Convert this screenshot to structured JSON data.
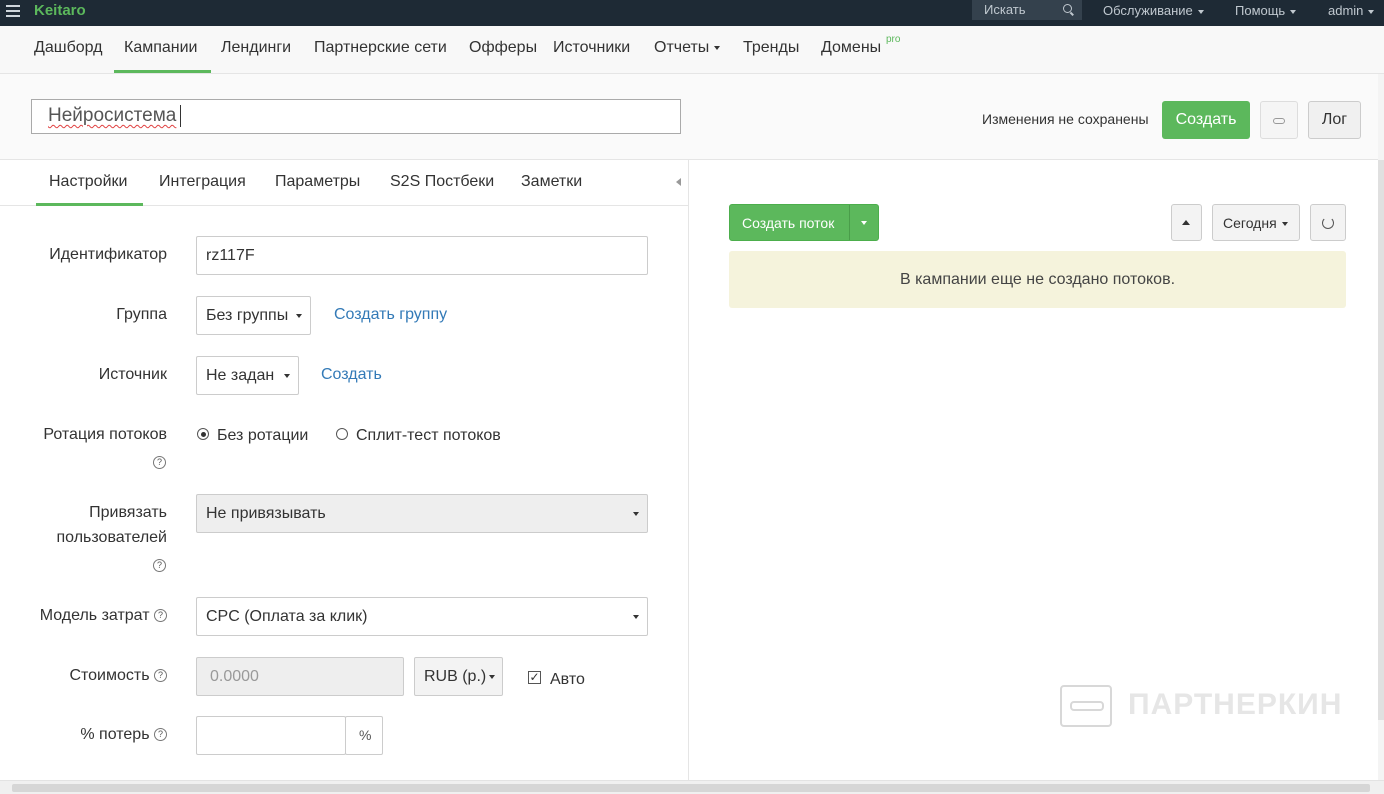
{
  "topbar": {
    "brand": "Keitaro",
    "search_placeholder": "Искать",
    "menu": [
      "Обслуживание",
      "Помощь",
      "admin"
    ]
  },
  "nav": {
    "items": [
      "Дашборд",
      "Кампании",
      "Лендинги",
      "Партнерские сети",
      "Офферы",
      "Источники",
      "Отчеты",
      "Тренды",
      "Домены"
    ],
    "active": "Кампании",
    "pro_badge": "pro"
  },
  "title_row": {
    "campaign_name": "Нейросистема",
    "unsaved_text": "Изменения не сохранены",
    "create_label": "Создать",
    "log_label": "Лог"
  },
  "tabs": [
    "Настройки",
    "Интеграция",
    "Параметры",
    "S2S Постбеки",
    "Заметки"
  ],
  "form": {
    "identifier_label": "Идентификатор",
    "identifier_value": "rz117F",
    "group_label": "Группа",
    "group_value": "Без группы",
    "group_create_link": "Создать группу",
    "source_label": "Источник",
    "source_value": "Не задан",
    "source_create_link": "Создать",
    "rotation_label": "Ротация потоков",
    "rotation_option_1": "Без ротации",
    "rotation_option_2": "Сплит-тест потоков",
    "bind_label_1": "Привязать",
    "bind_label_2": "пользователей",
    "bind_value": "Не привязывать",
    "cost_model_label": "Модель затрат",
    "cost_model_value": "CPC (Оплата за клик)",
    "cost_label": "Стоимость",
    "cost_placeholder": "0.0000",
    "currency_value": "RUB (р.)",
    "auto_label": "Авто",
    "loss_label": "% потерь",
    "loss_unit": "%",
    "help_glyph": "?"
  },
  "right": {
    "create_flow_label": "Создать поток",
    "date_range": "Сегодня",
    "empty_message": "В кампании еще не создано потоков."
  },
  "watermark": {
    "text": "ПАРТНЕРКИН"
  }
}
